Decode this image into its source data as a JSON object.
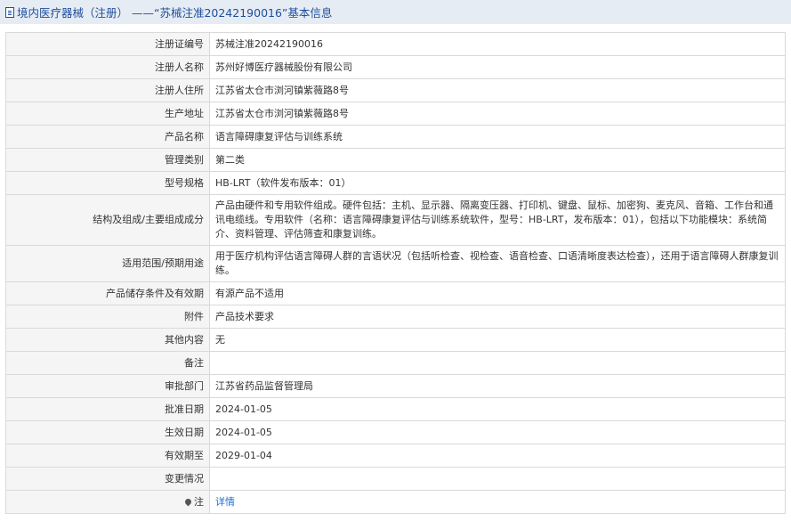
{
  "header": {
    "title": "境内医疗器械（注册） ——“苏械注准20242190016”基本信息"
  },
  "rows": [
    {
      "label": "注册证编号",
      "value": "苏械注准20242190016"
    },
    {
      "label": "注册人名称",
      "value": "苏州好博医疗器械股份有限公司"
    },
    {
      "label": "注册人住所",
      "value": "江苏省太仓市浏河镇紫薇路8号"
    },
    {
      "label": "生产地址",
      "value": "江苏省太仓市浏河镇紫薇路8号"
    },
    {
      "label": "产品名称",
      "value": "语言障碍康复评估与训练系统"
    },
    {
      "label": "管理类别",
      "value": "第二类"
    },
    {
      "label": "型号规格",
      "value": "HB-LRT（软件发布版本：01）"
    },
    {
      "label": "结构及组成/主要组成成分",
      "value": "产品由硬件和专用软件组成。硬件包括：主机、显示器、隔离变压器、打印机、键盘、鼠标、加密狗、麦克风、音箱、工作台和通讯电缆线。专用软件（名称：语言障碍康复评估与训练系统软件，型号：HB-LRT，发布版本：01），包括以下功能模块：系统简介、资料管理、评估筛查和康复训练。"
    },
    {
      "label": "适用范围/预期用途",
      "value": "用于医疗机构评估语言障碍人群的言语状况（包括听检查、视检查、语音检查、口语清晰度表达检查），还用于语言障碍人群康复训练。"
    },
    {
      "label": "产品储存条件及有效期",
      "value": "有源产品不适用"
    },
    {
      "label": "附件",
      "value": "产品技术要求"
    },
    {
      "label": "其他内容",
      "value": "无"
    },
    {
      "label": "备注",
      "value": ""
    },
    {
      "label": "审批部门",
      "value": "江苏省药品监督管理局"
    },
    {
      "label": "批准日期",
      "value": "2024-01-05"
    },
    {
      "label": "生效日期",
      "value": "2024-01-05"
    },
    {
      "label": "有效期至",
      "value": "2029-01-04"
    },
    {
      "label": "变更情况",
      "value": ""
    }
  ],
  "footer_row": {
    "label": "注",
    "link_text": "详情",
    "icon": "map-pin-icon"
  }
}
